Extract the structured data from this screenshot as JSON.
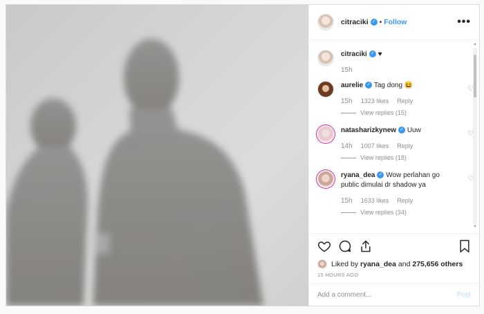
{
  "post": {
    "author": "citraciki",
    "follow_label": "Follow",
    "dot": "•",
    "more_label": "•••",
    "caption": {
      "username": "citraciki",
      "text": "♥",
      "time": "15h"
    },
    "comments": [
      {
        "username": "aurelie",
        "text": "Tag dong 😆",
        "time": "15h",
        "likes": "1323 likes",
        "reply_label": "Reply",
        "view_replies": "View replies (15)",
        "avatar": "brown"
      },
      {
        "username": "natasharizkynew",
        "text": "Uuw",
        "time": "14h",
        "likes": "1007 likes",
        "reply_label": "Reply",
        "view_replies": "View replies (18)",
        "avatar": "pink"
      },
      {
        "username": "ryana_dea",
        "text": "Wow perlahan go public dimulai dr shadow ya",
        "time": "15h",
        "likes": "1633 likes",
        "reply_label": "Reply",
        "view_replies": "View replies (34)",
        "avatar": "dea"
      }
    ],
    "liked_by": {
      "prefix": "Liked by",
      "user": "ryana_dea",
      "middle": "and",
      "count": "275,656 others"
    },
    "time_ago": "15 HOURS AGO",
    "add_comment_placeholder": "Add a comment...",
    "post_label": "Post",
    "icons": {
      "like": "heart-icon",
      "comment": "comment-icon",
      "share": "share-icon",
      "save": "bookmark-icon",
      "verified": "verified-badge-icon"
    },
    "colors": {
      "link": "#3897f0",
      "post_disabled": "#b2dffc",
      "muted": "#8e8e8e",
      "text": "#262626"
    }
  }
}
